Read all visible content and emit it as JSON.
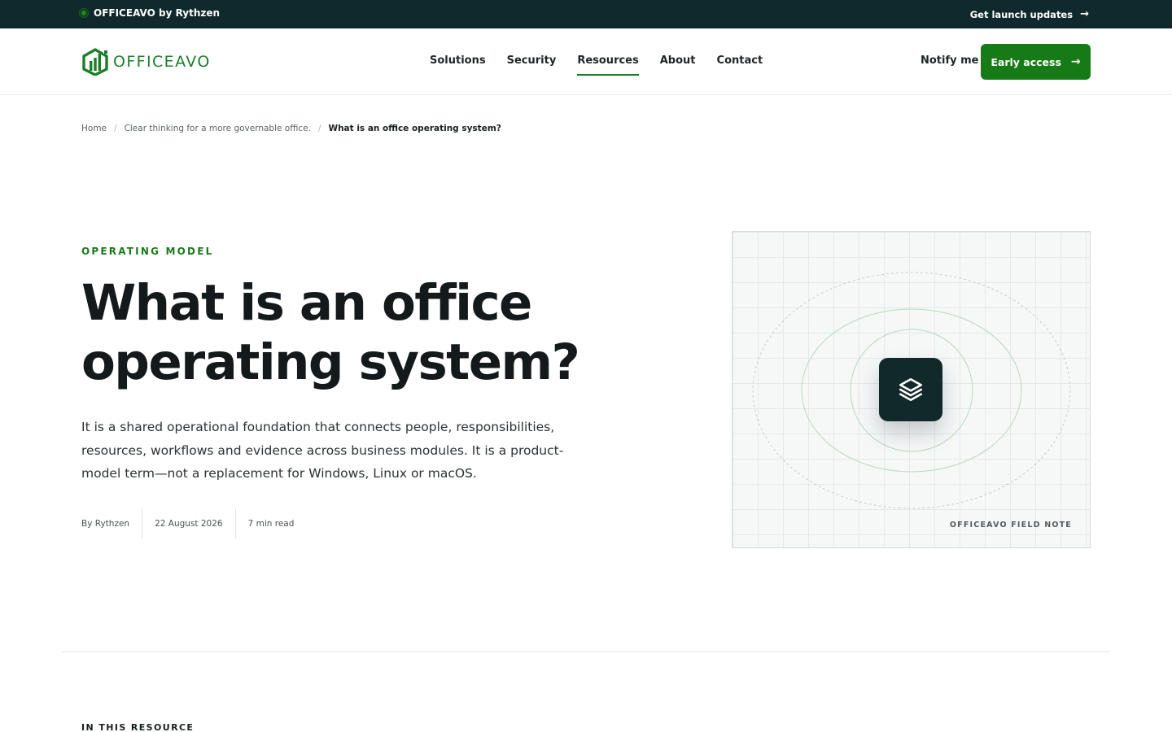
{
  "announcement": {
    "brand": "OFFICEAVO by Rythzen",
    "updates_label": "Get launch updates",
    "arrow_icon": "arrow-right-icon"
  },
  "header": {
    "logo_text": "OFFICEAVO",
    "nav": [
      {
        "label": "Solutions",
        "active": false
      },
      {
        "label": "Security",
        "active": false
      },
      {
        "label": "Resources",
        "active": true
      },
      {
        "label": "About",
        "active": false
      },
      {
        "label": "Contact",
        "active": false
      }
    ],
    "notify_label": "Notify me",
    "cta_label": "Early access"
  },
  "breadcrumb": {
    "home": "Home",
    "parent": "Clear thinking for a more governable office.",
    "current": "What is an office operating system?",
    "separator": "/"
  },
  "hero": {
    "kicker": "OPERATING MODEL",
    "title": "What is an office operating system?",
    "lede": "It is a shared operational foundation that connects people, responsibilities, resources, workflows and evidence across business modules. It is a product-model term—not a replacement for Windows, Linux or macOS.",
    "meta": {
      "author": "By Rythzen",
      "date": "22 August 2026",
      "read_time": "7 min read"
    }
  },
  "figure": {
    "icon": "layers-icon",
    "caption": "OFFICEAVO FIELD NOTE"
  },
  "section": {
    "title": "IN THIS RESOURCE"
  },
  "colors": {
    "brand_green": "#167a16",
    "dark_teal": "#10292c",
    "text": "#141a1b"
  }
}
